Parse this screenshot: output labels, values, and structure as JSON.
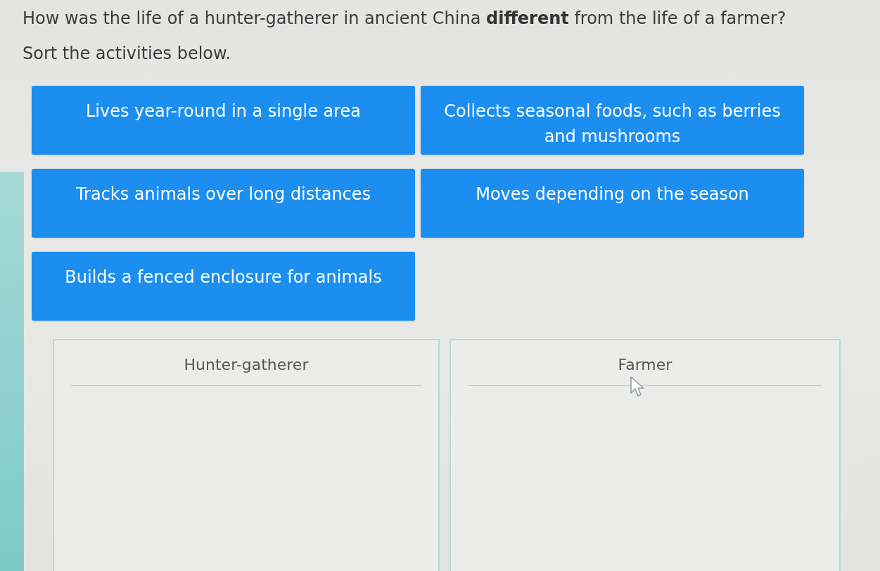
{
  "question": "How was the life of a hunter-gatherer in ancient China **different** from the life of a farmer?",
  "instruction": "Sort the activities below.",
  "cards": [
    {
      "label": "Lives year-round in a single area"
    },
    {
      "label": "Collects seasonal foods, such as berries and mushrooms"
    },
    {
      "label": "Tracks animals over long distances"
    },
    {
      "label": "Moves depending on the season"
    },
    {
      "label": "Builds a fenced enclosure for animals"
    }
  ],
  "bins": [
    {
      "title": "Hunter-gatherer"
    },
    {
      "title": "Farmer"
    }
  ]
}
